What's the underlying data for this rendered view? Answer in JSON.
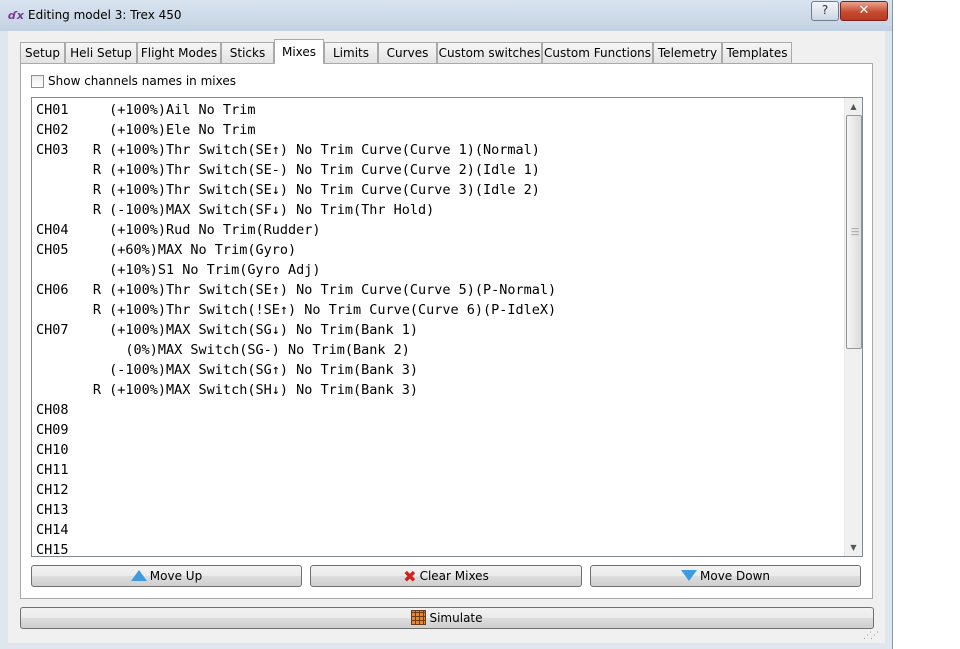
{
  "window": {
    "title": "Editing model 3: Trex 450",
    "app_icon": "companion-app-icon",
    "help_label": "?",
    "close_label": "✕"
  },
  "tabs": [
    {
      "label": "Setup",
      "active": false
    },
    {
      "label": "Heli Setup",
      "active": false
    },
    {
      "label": "Flight Modes",
      "active": false
    },
    {
      "label": "Sticks",
      "active": false
    },
    {
      "label": "Mixes",
      "active": true
    },
    {
      "label": "Limits",
      "active": false
    },
    {
      "label": "Curves",
      "active": false
    },
    {
      "label": "Custom switches",
      "active": false
    },
    {
      "label": "Custom Functions",
      "active": false
    },
    {
      "label": "Telemetry",
      "active": false
    },
    {
      "label": "Templates",
      "active": false
    }
  ],
  "mixes_panel": {
    "show_names_label": "Show channels names in mixes",
    "show_names_checked": false,
    "rows": [
      "CH01     (+100%)Ail No Trim",
      "CH02     (+100%)Ele No Trim",
      "CH03   R (+100%)Thr Switch(SE↑) No Trim Curve(Curve 1)(Normal)",
      "       R (+100%)Thr Switch(SE-) No Trim Curve(Curve 2)(Idle 1)",
      "       R (+100%)Thr Switch(SE↓) No Trim Curve(Curve 3)(Idle 2)",
      "       R (-100%)MAX Switch(SF↓) No Trim(Thr Hold)",
      "CH04     (+100%)Rud No Trim(Rudder)",
      "CH05     (+60%)MAX No Trim(Gyro)",
      "         (+10%)S1 No Trim(Gyro Adj)",
      "CH06   R (+100%)Thr Switch(SE↑) No Trim Curve(Curve 5)(P-Normal)",
      "       R (+100%)Thr Switch(!SE↑) No Trim Curve(Curve 6)(P-IdleX)",
      "CH07     (+100%)MAX Switch(SG↓) No Trim(Bank 1)",
      "           (0%)MAX Switch(SG-) No Trim(Bank 2)",
      "         (-100%)MAX Switch(SG↑) No Trim(Bank 3)",
      "       R (+100%)MAX Switch(SH↓) No Trim(Bank 3)",
      "CH08",
      "CH09",
      "CH10",
      "CH11",
      "CH12",
      "CH13",
      "CH14",
      "CH15"
    ],
    "scroll_position": 0.0
  },
  "buttons": {
    "move_up": {
      "label": "Move Up",
      "icon": "arrow-up-icon"
    },
    "clear_mixes": {
      "label": "Clear Mixes",
      "icon": "red-x-icon"
    },
    "move_down": {
      "label": "Move Down",
      "icon": "arrow-down-icon"
    },
    "simulate": {
      "label": "Simulate",
      "icon": "simulator-icon"
    }
  },
  "colors": {
    "accent_arrow": "#3f9be0",
    "clear_red": "#d0231f",
    "close_red": "#c74b30"
  }
}
